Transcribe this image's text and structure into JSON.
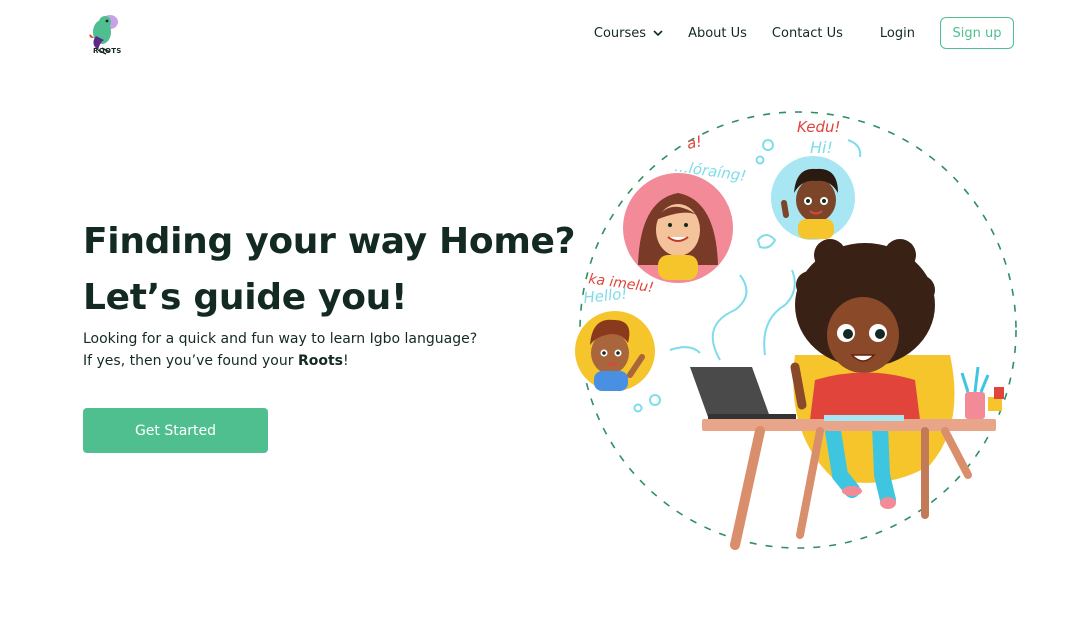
{
  "brand": {
    "name": "ROOTS"
  },
  "nav": {
    "courses": "Courses",
    "about": "About Us",
    "contact": "Contact Us",
    "login": "Login",
    "signup": "Sign up"
  },
  "hero": {
    "headline_1": "Finding your way Home?",
    "headline_2": "Let’s guide you!",
    "subtext_prefix": "Looking for a quick and fun way to learn Igbo language? If yes, then you’ve found your ",
    "subtext_bold": "Roots",
    "subtext_suffix": "!",
    "cta": "Get Started"
  },
  "illustration": {
    "bubble_top_left_red": "a!",
    "bubble_top_left_blue": "...lóraíng!",
    "bubble_top_right_red": "Kedu!",
    "bubble_top_right_blue": "Hi!",
    "bubble_left_red": "ka imelu!",
    "bubble_left_blue": "Hello!"
  },
  "colors": {
    "accent": "#4fbf8f",
    "text": "#132a22",
    "illustration_red": "#e0443a",
    "illustration_cyan": "#7fdcea"
  }
}
